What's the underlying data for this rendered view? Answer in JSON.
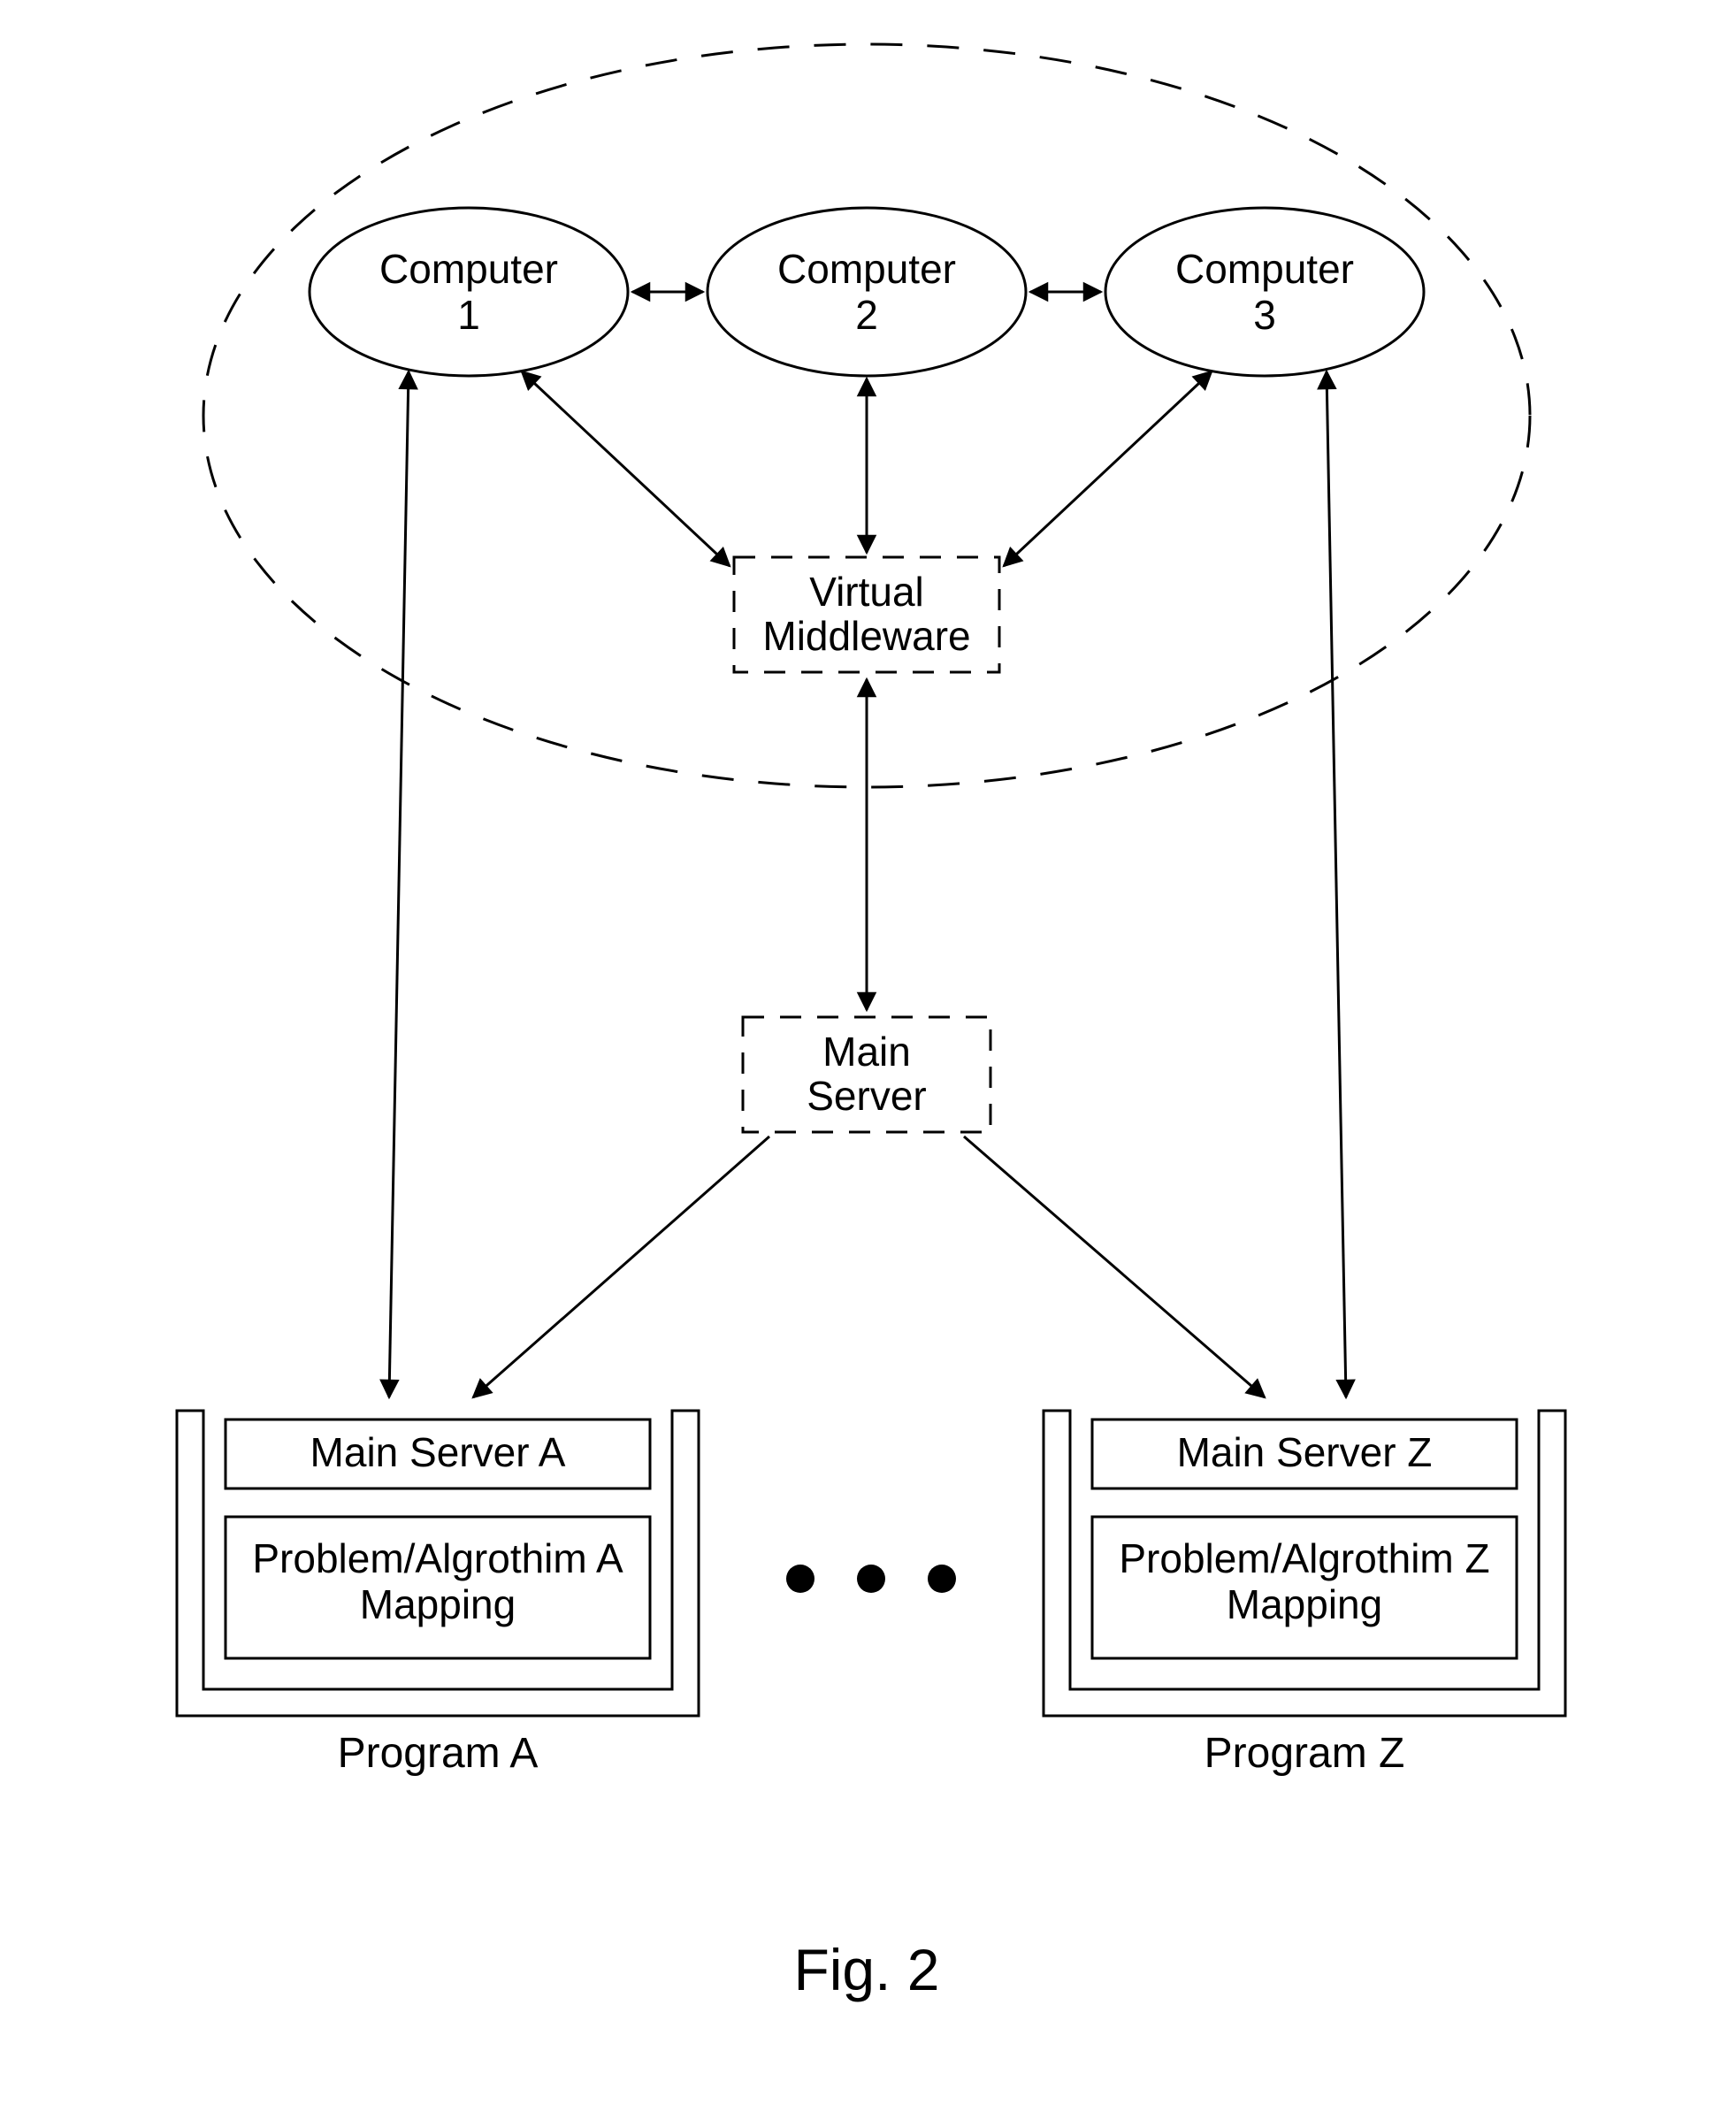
{
  "nodes": {
    "computer1": {
      "line1": "Computer",
      "line2": "1"
    },
    "computer2": {
      "line1": "Computer",
      "line2": "2"
    },
    "computer3": {
      "line1": "Computer",
      "line2": "3"
    },
    "virtualMiddleware": {
      "line1": "Virtual",
      "line2": "Middleware"
    },
    "mainServer": {
      "line1": "Main",
      "line2": "Server"
    },
    "programA": {
      "mainServer": "Main Server A",
      "mapping_line1": "Problem/Algrothim A",
      "mapping_line2": "Mapping",
      "program": "Program A"
    },
    "programZ": {
      "mainServer": "Main Server Z",
      "mapping_line1": "Problem/Algrothim Z",
      "mapping_line2": "Mapping",
      "program": "Program Z"
    }
  },
  "caption": "Fig. 2",
  "ellipsis": "•  •  •"
}
